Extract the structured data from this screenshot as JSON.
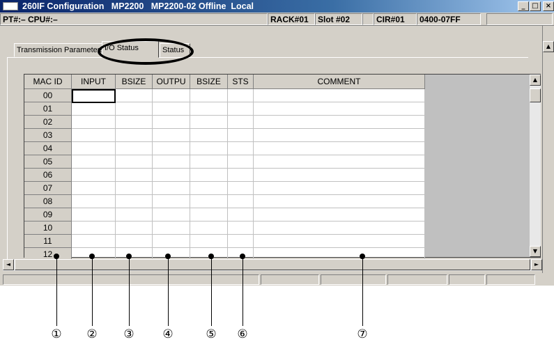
{
  "window": {
    "title": "260IF Configuration   MP2200   MP2200-02 Offline  Local",
    "buttons": {
      "minimize": "_",
      "maximize": "□",
      "close": "×"
    }
  },
  "infobar": {
    "pt_cpu": "PT#:– CPU#:–",
    "rack": "RACK#01",
    "slot": "Slot #02",
    "cir": "CIR#01",
    "range": "0400-07FF"
  },
  "tabs": [
    {
      "label": "Transmission Parameters",
      "selected": false
    },
    {
      "label": "I/O Status",
      "selected": true
    },
    {
      "label": "Status",
      "selected": false
    }
  ],
  "grid": {
    "columns": [
      "MAC ID",
      "INPUT",
      "BSIZE",
      "OUTPU",
      "BSIZE",
      "STS",
      "COMMENT"
    ],
    "rows": [
      "00",
      "01",
      "02",
      "03",
      "04",
      "05",
      "06",
      "07",
      "08",
      "09",
      "10",
      "11",
      "12"
    ]
  },
  "scroll": {
    "up": "▲",
    "down": "▼",
    "left": "◄",
    "right": "►"
  },
  "callouts": [
    "①",
    "②",
    "③",
    "④",
    "⑤",
    "⑥",
    "⑦"
  ]
}
